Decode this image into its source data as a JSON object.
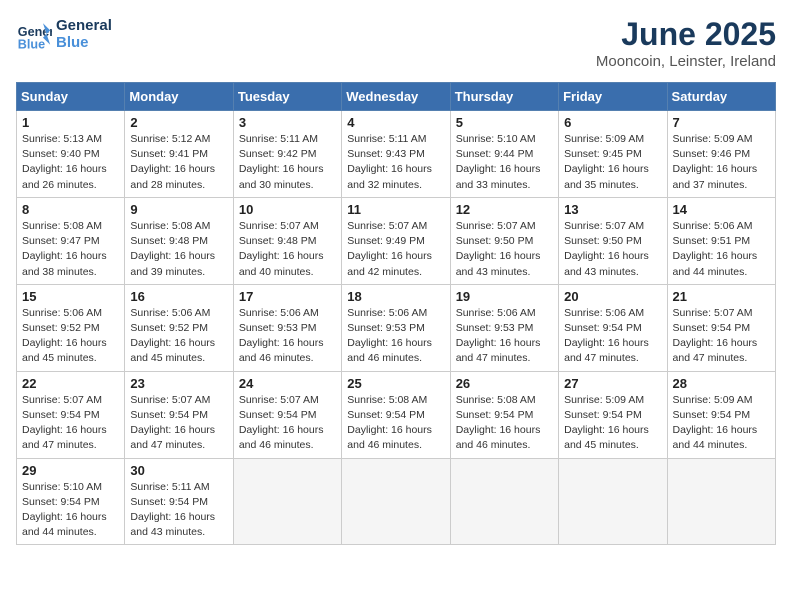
{
  "header": {
    "logo_line1": "General",
    "logo_line2": "Blue",
    "month_title": "June 2025",
    "location": "Mooncoin, Leinster, Ireland"
  },
  "days_of_week": [
    "Sunday",
    "Monday",
    "Tuesday",
    "Wednesday",
    "Thursday",
    "Friday",
    "Saturday"
  ],
  "weeks": [
    [
      {
        "num": "1",
        "rise": "5:13 AM",
        "set": "9:40 PM",
        "daylight": "16 hours and 26 minutes"
      },
      {
        "num": "2",
        "rise": "5:12 AM",
        "set": "9:41 PM",
        "daylight": "16 hours and 28 minutes"
      },
      {
        "num": "3",
        "rise": "5:11 AM",
        "set": "9:42 PM",
        "daylight": "16 hours and 30 minutes"
      },
      {
        "num": "4",
        "rise": "5:11 AM",
        "set": "9:43 PM",
        "daylight": "16 hours and 32 minutes"
      },
      {
        "num": "5",
        "rise": "5:10 AM",
        "set": "9:44 PM",
        "daylight": "16 hours and 33 minutes"
      },
      {
        "num": "6",
        "rise": "5:09 AM",
        "set": "9:45 PM",
        "daylight": "16 hours and 35 minutes"
      },
      {
        "num": "7",
        "rise": "5:09 AM",
        "set": "9:46 PM",
        "daylight": "16 hours and 37 minutes"
      }
    ],
    [
      {
        "num": "8",
        "rise": "5:08 AM",
        "set": "9:47 PM",
        "daylight": "16 hours and 38 minutes"
      },
      {
        "num": "9",
        "rise": "5:08 AM",
        "set": "9:48 PM",
        "daylight": "16 hours and 39 minutes"
      },
      {
        "num": "10",
        "rise": "5:07 AM",
        "set": "9:48 PM",
        "daylight": "16 hours and 40 minutes"
      },
      {
        "num": "11",
        "rise": "5:07 AM",
        "set": "9:49 PM",
        "daylight": "16 hours and 42 minutes"
      },
      {
        "num": "12",
        "rise": "5:07 AM",
        "set": "9:50 PM",
        "daylight": "16 hours and 43 minutes"
      },
      {
        "num": "13",
        "rise": "5:07 AM",
        "set": "9:50 PM",
        "daylight": "16 hours and 43 minutes"
      },
      {
        "num": "14",
        "rise": "5:06 AM",
        "set": "9:51 PM",
        "daylight": "16 hours and 44 minutes"
      }
    ],
    [
      {
        "num": "15",
        "rise": "5:06 AM",
        "set": "9:52 PM",
        "daylight": "16 hours and 45 minutes"
      },
      {
        "num": "16",
        "rise": "5:06 AM",
        "set": "9:52 PM",
        "daylight": "16 hours and 45 minutes"
      },
      {
        "num": "17",
        "rise": "5:06 AM",
        "set": "9:53 PM",
        "daylight": "16 hours and 46 minutes"
      },
      {
        "num": "18",
        "rise": "5:06 AM",
        "set": "9:53 PM",
        "daylight": "16 hours and 46 minutes"
      },
      {
        "num": "19",
        "rise": "5:06 AM",
        "set": "9:53 PM",
        "daylight": "16 hours and 47 minutes"
      },
      {
        "num": "20",
        "rise": "5:06 AM",
        "set": "9:54 PM",
        "daylight": "16 hours and 47 minutes"
      },
      {
        "num": "21",
        "rise": "5:07 AM",
        "set": "9:54 PM",
        "daylight": "16 hours and 47 minutes"
      }
    ],
    [
      {
        "num": "22",
        "rise": "5:07 AM",
        "set": "9:54 PM",
        "daylight": "16 hours and 47 minutes"
      },
      {
        "num": "23",
        "rise": "5:07 AM",
        "set": "9:54 PM",
        "daylight": "16 hours and 47 minutes"
      },
      {
        "num": "24",
        "rise": "5:07 AM",
        "set": "9:54 PM",
        "daylight": "16 hours and 46 minutes"
      },
      {
        "num": "25",
        "rise": "5:08 AM",
        "set": "9:54 PM",
        "daylight": "16 hours and 46 minutes"
      },
      {
        "num": "26",
        "rise": "5:08 AM",
        "set": "9:54 PM",
        "daylight": "16 hours and 46 minutes"
      },
      {
        "num": "27",
        "rise": "5:09 AM",
        "set": "9:54 PM",
        "daylight": "16 hours and 45 minutes"
      },
      {
        "num": "28",
        "rise": "5:09 AM",
        "set": "9:54 PM",
        "daylight": "16 hours and 44 minutes"
      }
    ],
    [
      {
        "num": "29",
        "rise": "5:10 AM",
        "set": "9:54 PM",
        "daylight": "16 hours and 44 minutes"
      },
      {
        "num": "30",
        "rise": "5:11 AM",
        "set": "9:54 PM",
        "daylight": "16 hours and 43 minutes"
      },
      null,
      null,
      null,
      null,
      null
    ]
  ]
}
